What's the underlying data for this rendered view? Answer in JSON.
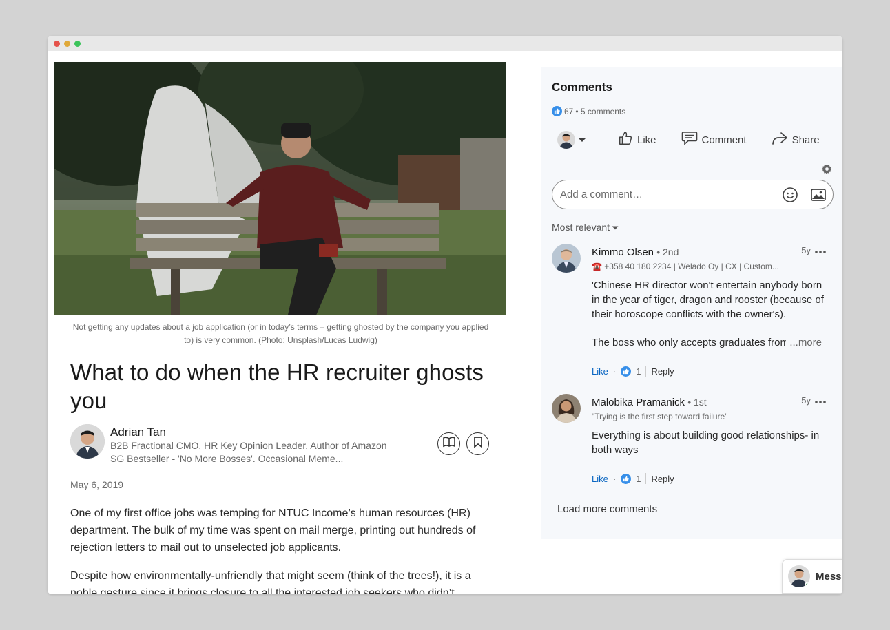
{
  "colors": {
    "accent": "#0a66c2",
    "like_badge": "#378fe9",
    "panel_bg": "#f6f8fb"
  },
  "article": {
    "hero_image": "ghost-on-bench-photo",
    "caption": "Not getting any updates about a job application (or in today’s terms – getting ghosted by the company you applied to) is very common. (Photo: Unsplash/Lucas Ludwig)",
    "title": "What to do when the HR recruiter ghosts you",
    "author": {
      "name": "Adrian Tan",
      "bio": "B2B Fractional CMO. HR Key Opinion Leader. Author of Amazon SG Bestseller - 'No More Bosses'. Occasional Meme..."
    },
    "date": "May 6, 2019",
    "paragraphs": [
      "One of my first office jobs was temping for NTUC Income’s human resources (HR) department. The bulk of my time was spent on mail merge, printing out hundreds of rejection letters to mail out to unselected job applicants.",
      "Despite how environmentally-unfriendly that might seem (think of the trees!), it is a noble gesture since it brings closure to all the interested job seekers who didn’t"
    ]
  },
  "comments": {
    "title": "Comments",
    "reaction_count": "67",
    "comment_count": "• 5 comments",
    "actions": {
      "like": "Like",
      "comment": "Comment",
      "share": "Share"
    },
    "placeholder": "Add a comment…",
    "sort": "Most relevant",
    "items": [
      {
        "name": "Kimmo Olsen",
        "degree": "• 2nd",
        "subtitle": "☎️ +358 40 180 2234 | Welado Oy | CX | Custom...",
        "time": "5y",
        "text": "'Chinese HR director won't entertain anybody born in the year of tiger, dragon and rooster (because of their horoscope conflicts with the owner's).",
        "text2": "The boss who only accepts graduates from",
        "more": "...more",
        "like": "Like",
        "likes": "1",
        "reply": "Reply"
      },
      {
        "name": "Malobika Pramanick",
        "degree": "• 1st",
        "subtitle": "\"Trying is the first step toward failure\"",
        "time": "5y",
        "text": "Everything is about building good relationships- in both ways",
        "like": "Like",
        "likes": "1",
        "reply": "Reply"
      }
    ],
    "load_more": "Load more comments"
  },
  "messaging": {
    "label": "Messa"
  }
}
